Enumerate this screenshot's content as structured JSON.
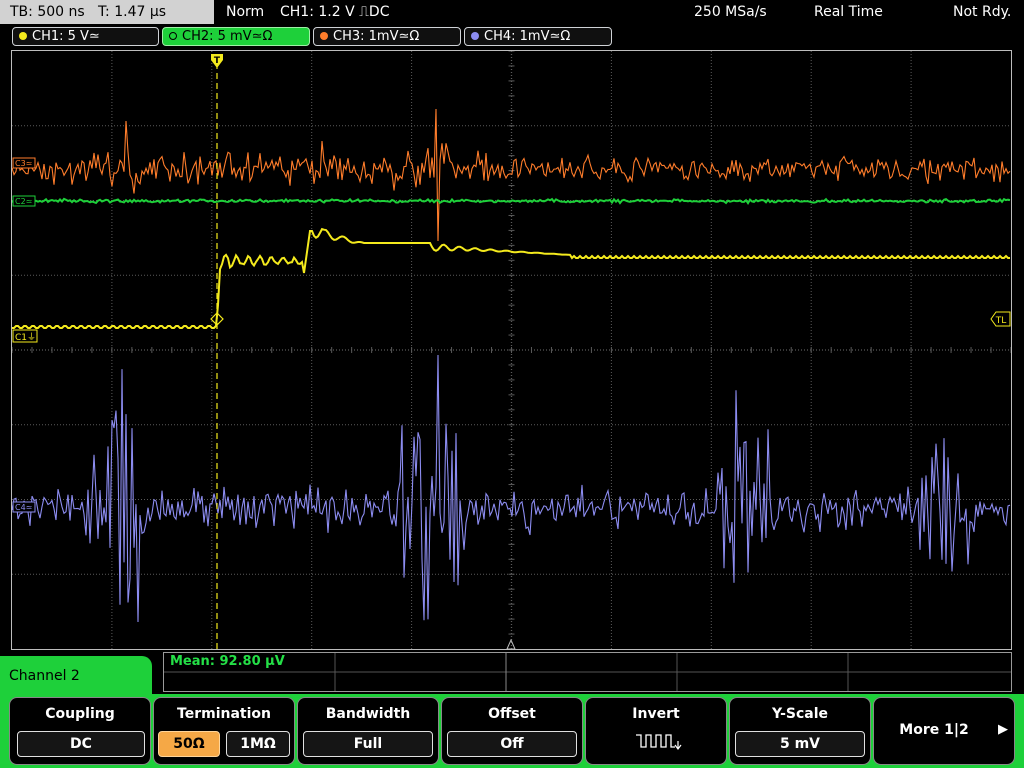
{
  "status_bar": {
    "timebase": "TB: 500 ns",
    "trigger_time": "T: 1.47 µs",
    "mode": "Norm",
    "trigger_setting": "CH1: 1.2 V ⎍DC",
    "sample_rate": "250 MSa/s",
    "acq_mode": "Real Time",
    "status": "Not Rdy."
  },
  "channels": [
    {
      "label": "CH1: 5 V≃",
      "color": "#f4ea1d"
    },
    {
      "label": "CH2: 5 mV≃Ω",
      "color": "#1ed03a"
    },
    {
      "label": "CH3: 1mV≃Ω",
      "color": "#ff7d2b"
    },
    {
      "label": "CH4: 1mV≃Ω",
      "color": "#8c8cf0"
    }
  ],
  "markers": {
    "trigger_top": "T",
    "trigger_level": "TL",
    "ch1_ref": "C1⏚",
    "ch2_ref": "C2≃",
    "ch3_ref": "C3≃",
    "ch4_ref": "C4≃"
  },
  "measurement": {
    "text": "Mean: 92.80 µV"
  },
  "menu": {
    "title": "Channel 2",
    "coupling": {
      "title": "Coupling",
      "value": "DC"
    },
    "termination": {
      "title": "Termination",
      "opt1": "50Ω",
      "opt2": "1MΩ"
    },
    "bandwidth": {
      "title": "Bandwidth",
      "value": "Full"
    },
    "offset": {
      "title": "Offset",
      "value": "Off"
    },
    "invert": {
      "title": "Invert"
    },
    "yscale": {
      "title": "Y-Scale",
      "value": "5 mV"
    },
    "more": {
      "title": "More 1|2",
      "arrow": "▶"
    }
  },
  "waveform_colors": {
    "ch1": "#f4ea1d",
    "ch2": "#1ed03a",
    "ch3": "#ff7d2b",
    "ch4": "#8c8cf0",
    "grid": "#5a5a5a"
  }
}
